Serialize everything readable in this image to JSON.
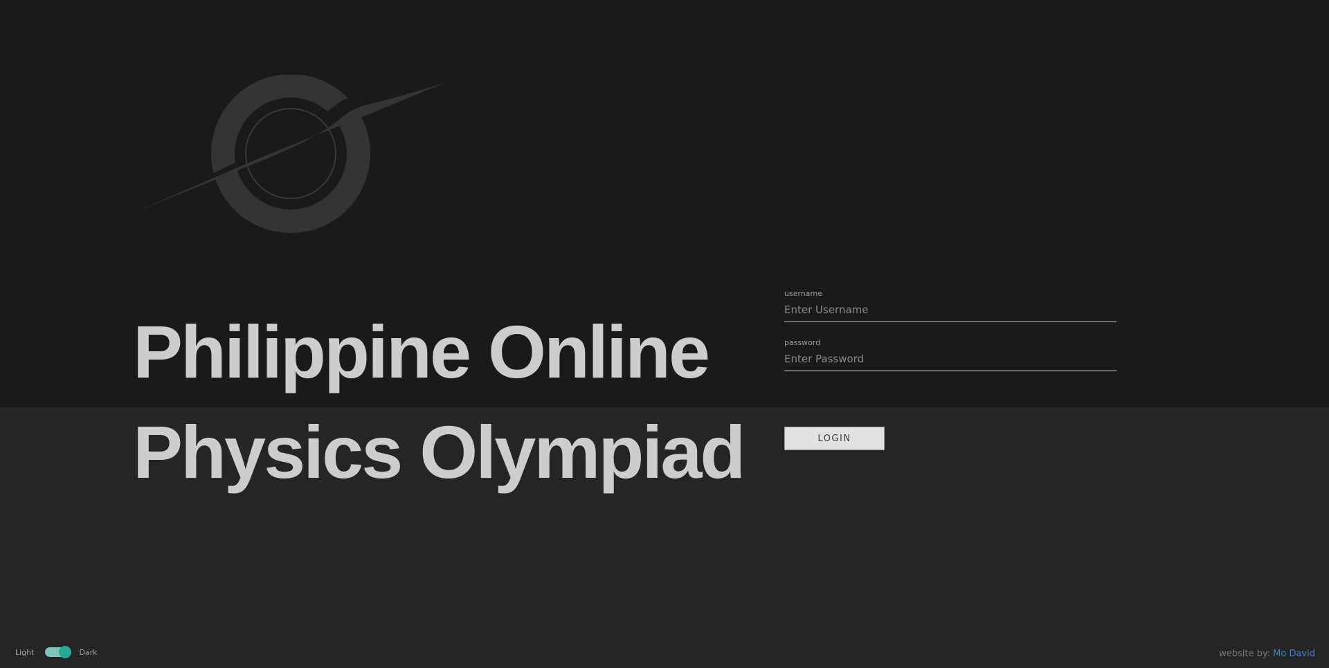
{
  "hero": {
    "title_line1": "Philippine Online",
    "title_line2": "Physics Olympiad"
  },
  "logo": {
    "icon": "black-hole-icon"
  },
  "login_form": {
    "username": {
      "label": "username",
      "placeholder": "Enter Username",
      "value": ""
    },
    "password": {
      "label": "password",
      "placeholder": "Enter Password",
      "value": ""
    },
    "submit_label": "LOGIN"
  },
  "theme_toggle": {
    "light_label": "Light",
    "dark_label": "Dark",
    "state": "dark"
  },
  "footer": {
    "credit_prefix": "website by: ",
    "author": "Mo David"
  },
  "colors": {
    "background_top": "#1a1a1a",
    "background_bottom": "#252525",
    "title_text": "#cdcdcd",
    "toggle_accent": "#28a893",
    "link": "#4a7fc4"
  }
}
